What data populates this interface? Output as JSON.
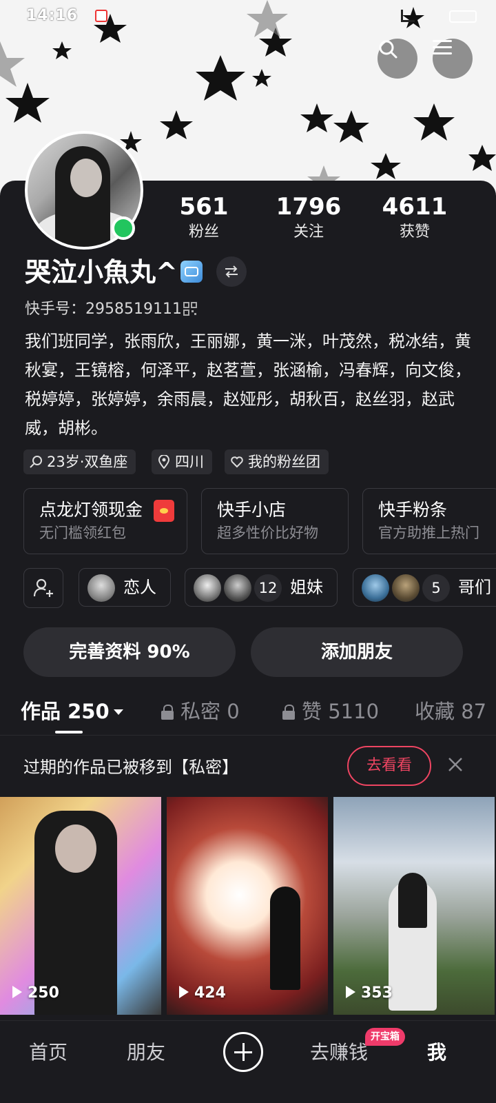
{
  "status_bar": {
    "time": "14:16"
  },
  "profile": {
    "stats": [
      {
        "value": "561",
        "label": "粉丝"
      },
      {
        "value": "1796",
        "label": "关注"
      },
      {
        "value": "4611",
        "label": "获赞"
      }
    ],
    "nickname": "哭泣小魚丸^",
    "kuaishou_id": "快手号：2958519111",
    "bio": "我们班同学，张雨欣，王丽娜，黄一洣，叶茂然，税冰结，黄秋宴，王镜榕，何泽平，赵茗萱，张涵榆，冯春辉，向文俊，税婷婷，张婷婷，余雨晨，赵娅彤，胡秋百，赵丝羽，赵武威，胡彬。",
    "tags": [
      "23岁·双鱼座",
      "四川",
      "我的粉丝团"
    ]
  },
  "features": [
    {
      "title": "点龙灯领现金",
      "subtitle": "无门槛领红包"
    },
    {
      "title": "快手小店",
      "subtitle": "超多性价比好物"
    },
    {
      "title": "快手粉条",
      "subtitle": "官方助推上热门"
    }
  ],
  "relations": [
    {
      "label": "恋人",
      "count": ""
    },
    {
      "label": "姐妹",
      "count": "12"
    },
    {
      "label": "哥们",
      "count": "5"
    }
  ],
  "actions": {
    "complete_profile": "完善资料 90%",
    "add_friend": "添加朋友"
  },
  "tabs": [
    {
      "label": "作品 250",
      "active": true
    },
    {
      "label": "私密 0",
      "active": false
    },
    {
      "label": "赞 5110",
      "active": false
    },
    {
      "label": "收藏 87",
      "active": false
    }
  ],
  "notice": {
    "text": "过期的作品已被移到【私密】",
    "button": "去看看"
  },
  "videos": [
    {
      "plays": "250"
    },
    {
      "plays": "424"
    },
    {
      "plays": "353"
    }
  ],
  "bottom_nav": {
    "home": "首页",
    "friends": "朋友",
    "earn": "去赚钱",
    "earn_badge": "开宝箱",
    "me": "我"
  },
  "colors": {
    "background": "#1b1b1f",
    "accent": "#ef4562",
    "online": "#22c55e"
  }
}
